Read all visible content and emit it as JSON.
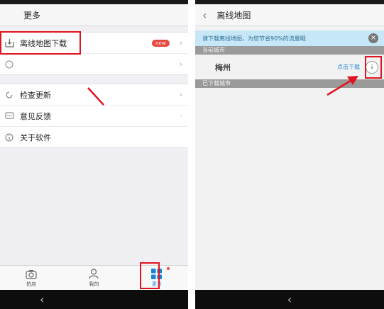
{
  "left": {
    "title": "更多",
    "menu_group_1": [
      {
        "label": "离线地图下载",
        "badge": "new"
      },
      {
        "label": ""
      }
    ],
    "menu_group_2": [
      {
        "label": "检查更新"
      },
      {
        "label": "意见反馈"
      },
      {
        "label": "关于软件"
      }
    ],
    "tabs": [
      {
        "label": "拍店",
        "icon": "camera-icon"
      },
      {
        "label": "我的",
        "icon": "person-icon"
      },
      {
        "label": "更多",
        "icon": "grid-icon"
      }
    ]
  },
  "right": {
    "title": "离线地图",
    "notice": "请下载离线地图，为您节省90%的流量哦",
    "current_city_header": "当前城市",
    "city_name": "梅州",
    "download_label": "点击下载",
    "downloaded_header": "已下载城市"
  },
  "colors": {
    "highlight": "#e0141e",
    "accent": "#1a83d6",
    "badge": "#e8483f",
    "notice_bg": "#c6e7f7"
  }
}
